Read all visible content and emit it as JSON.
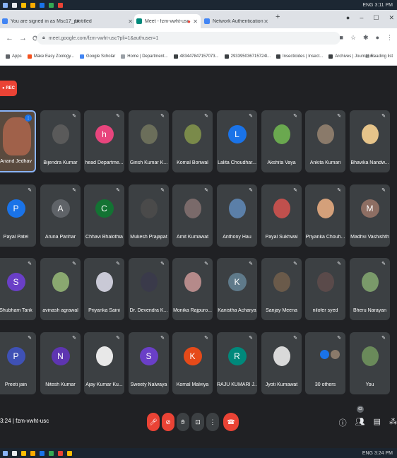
{
  "browser": {
    "tabs": [
      {
        "label": "You are signed in as Msc17_prod",
        "color": "#4285f4",
        "active": false
      },
      {
        "label": "Untitled",
        "color": "#9aa0a6",
        "active": false
      },
      {
        "label": "Meet - fzm-vwht-usc",
        "color": "#00897b",
        "active": true
      },
      {
        "label": "Network Authentication",
        "color": "#4285f4",
        "active": false
      }
    ],
    "new_tab": "+",
    "url": "meet.google.com/fzm-vwht-usc?pli=1&authuser=1",
    "bookmarks": [
      {
        "label": "Apps",
        "color": "#5f6368"
      },
      {
        "label": "Make Easy Zoology...",
        "color": "#f4511e"
      },
      {
        "label": "Google Scholar",
        "color": "#4285f4"
      },
      {
        "label": "Home | Department...",
        "color": "#9aa0a6"
      },
      {
        "label": "483447847157073...",
        "color": "#3c4043"
      },
      {
        "label": "293395036715724l...",
        "color": "#3c4043"
      },
      {
        "label": "Insecticides | Insect...",
        "color": "#3c4043"
      },
      {
        "label": "Archives | Journal o...",
        "color": "#3c4043"
      }
    ],
    "reading_list": "Reading list"
  },
  "taskbar": {
    "top_right": "ENG  3:11 PM",
    "bottom_right": "ENG  3:24 PM"
  },
  "meet": {
    "rec_label": "REC",
    "meeting_time": "3:24",
    "meeting_code": "fzm-vwht-usc",
    "participant_count": "63",
    "participants": [
      {
        "name": "Anand Jedhav",
        "kind": "speaker"
      },
      {
        "name": "Bijendra Kumar",
        "kind": "photo",
        "color": "#5a5a5a"
      },
      {
        "name": "head Departme...",
        "kind": "letter",
        "letter": "h",
        "color": "#e8457d"
      },
      {
        "name": "Girish Kumar K...",
        "kind": "photo",
        "color": "#6b6e5a"
      },
      {
        "name": "Komal Boriwal",
        "kind": "photo",
        "color": "#7a8a4a"
      },
      {
        "name": "Lalita Choudhar...",
        "kind": "letter",
        "letter": "L",
        "color": "#1a73e8"
      },
      {
        "name": "Akshita Vaya",
        "kind": "photo",
        "color": "#6aa84f"
      },
      {
        "name": "Ankita Kumari",
        "kind": "photo",
        "color": "#8a7a6a"
      },
      {
        "name": "Bhavika Nandw...",
        "kind": "photo",
        "color": "#e6c48a"
      },
      {
        "name": "Payal Patel",
        "kind": "letter",
        "letter": "P",
        "color": "#1a73e8"
      },
      {
        "name": "Aruna Parihar",
        "kind": "letter",
        "letter": "A",
        "color": "#5f6368"
      },
      {
        "name": "Chhavi Bhalothia",
        "kind": "letter",
        "letter": "C",
        "color": "#137333"
      },
      {
        "name": "Mukesh Prajapat",
        "kind": "photo",
        "color": "#4a4a4a"
      },
      {
        "name": "Amit Kumawat",
        "kind": "photo",
        "color": "#7a6a6a"
      },
      {
        "name": "Anthony Hau",
        "kind": "photo",
        "color": "#5b7fa8"
      },
      {
        "name": "Payal Sukhwal",
        "kind": "photo",
        "color": "#c0504d"
      },
      {
        "name": "Priyanka Chouh...",
        "kind": "photo",
        "color": "#d4a07a"
      },
      {
        "name": "Madhvi Vashishth",
        "kind": "letter",
        "letter": "M",
        "color": "#8d6e63"
      },
      {
        "name": "Shubham Tank",
        "kind": "letter",
        "letter": "S",
        "color": "#6a3fc7"
      },
      {
        "name": "avinash agrawal",
        "kind": "photo",
        "color": "#8aa870"
      },
      {
        "name": "Priyanka Saini",
        "kind": "photo",
        "color": "#c9c9d6"
      },
      {
        "name": "Dr. Devendra K...",
        "kind": "photo",
        "color": "#3a3a4a"
      },
      {
        "name": "Monika Rajpuro...",
        "kind": "photo",
        "color": "#b58a8a"
      },
      {
        "name": "Kanistha Acharya",
        "kind": "letter",
        "letter": "K",
        "color": "#5f7a8a"
      },
      {
        "name": "Sanjay Meena",
        "kind": "photo",
        "color": "#6a5a4a"
      },
      {
        "name": "nilofer syed",
        "kind": "photo",
        "color": "#5a4a4a"
      },
      {
        "name": "Bheru Narayan",
        "kind": "photo",
        "color": "#7a9a6a"
      },
      {
        "name": "Preeti jain",
        "kind": "letter",
        "letter": "P",
        "color": "#3f51b5"
      },
      {
        "name": "Nitesh Kumar",
        "kind": "letter",
        "letter": "N",
        "color": "#5e35b1"
      },
      {
        "name": "Ajay Kumar Ku...",
        "kind": "photo",
        "color": "#e8e8e8"
      },
      {
        "name": "Sweety Nalwaya",
        "kind": "letter",
        "letter": "S",
        "color": "#6a3fc7"
      },
      {
        "name": "Komal Malviya",
        "kind": "letter",
        "letter": "K",
        "color": "#e64a19"
      },
      {
        "name": "RAJU KUMARI J...",
        "kind": "letter",
        "letter": "R",
        "color": "#00897b"
      },
      {
        "name": "Jyoti Kumawat",
        "kind": "photo",
        "color": "#d9d9d9"
      },
      {
        "name": "30 others",
        "kind": "others"
      },
      {
        "name": "You",
        "kind": "photo",
        "color": "#6a8a5a"
      }
    ]
  }
}
